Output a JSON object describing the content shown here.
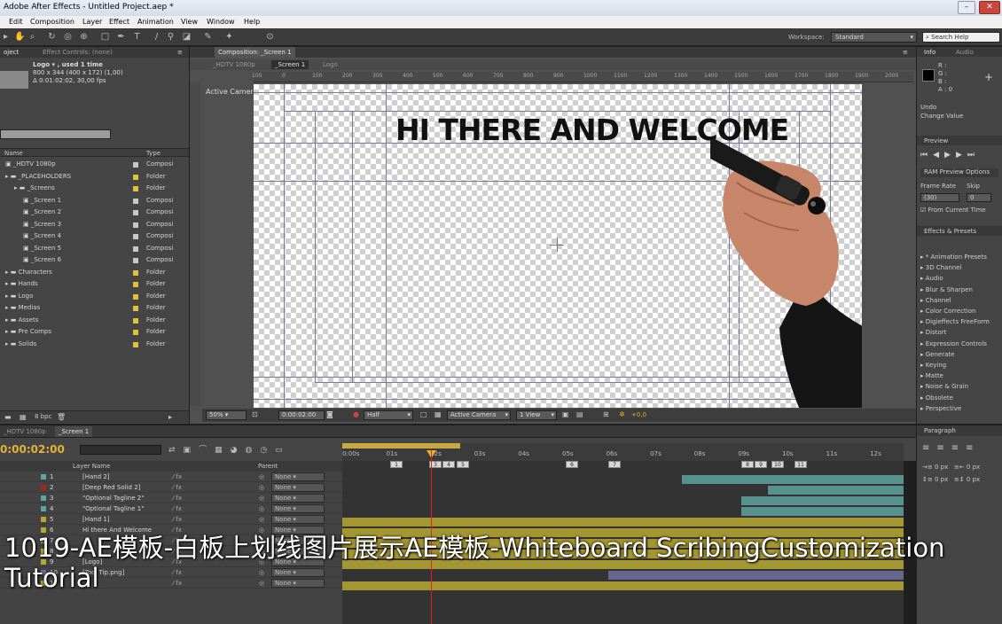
{
  "window": {
    "title": "Adobe After Effects - Untitled Project.aep *"
  },
  "menu": [
    "Edit",
    "Composition",
    "Layer",
    "Effect",
    "Animation",
    "View",
    "Window",
    "Help"
  ],
  "toolbar": {
    "workspace_label": "Workspace:",
    "workspace_value": "Standard",
    "search_help_placeholder": "Search Help"
  },
  "project": {
    "tab_project": "oject",
    "tab_effect_controls": "Effect Controls: (none)",
    "selected_name": "Logo ▾ , used 1 time",
    "selected_dims": "800 x 344  (400 x 172) (1,00)",
    "selected_duration": "Δ 0:01:02:02, 30,00 fps",
    "col_name": "Name",
    "col_type": "Type",
    "items": [
      {
        "name": "_HDTV 1080p",
        "type": "Composi",
        "color": "#c8c8c8"
      },
      {
        "name": "_PLACEHOLDERS",
        "type": "Folder",
        "color": "#e0c040"
      },
      {
        "name": "_Screens",
        "type": "Folder",
        "color": "#e0c040"
      },
      {
        "name": "_Screen 1",
        "type": "Composi",
        "color": "#c8c8c8"
      },
      {
        "name": "_Screen 2",
        "type": "Composi",
        "color": "#c8c8c8"
      },
      {
        "name": "_Screen 3",
        "type": "Composi",
        "color": "#c8c8c8"
      },
      {
        "name": "_Screen 4",
        "type": "Composi",
        "color": "#c8c8c8"
      },
      {
        "name": "_Screen 5",
        "type": "Composi",
        "color": "#c8c8c8"
      },
      {
        "name": "_Screen 6",
        "type": "Composi",
        "color": "#c8c8c8"
      },
      {
        "name": "Characters",
        "type": "Folder",
        "color": "#e0c040"
      },
      {
        "name": "Hands",
        "type": "Folder",
        "color": "#e0c040"
      },
      {
        "name": "Logo",
        "type": "Folder",
        "color": "#e0c040"
      },
      {
        "name": "Medias",
        "type": "Folder",
        "color": "#e0c040"
      },
      {
        "name": "Assets",
        "type": "Folder",
        "color": "#e0c040"
      },
      {
        "name": "Pre Comps",
        "type": "Folder",
        "color": "#e0c040"
      },
      {
        "name": "Solids",
        "type": "Folder",
        "color": "#e0c040"
      }
    ],
    "bpc": "8 bpc"
  },
  "composition": {
    "tab": "Composition: _Screen 1",
    "breadcrumb": [
      "_HDTV 1080p",
      "_Screen 1",
      "Logo"
    ],
    "camera_label": "Active Camera",
    "headline": "HI THERE AND WELCOME",
    "ruler_ticks": [
      "100",
      "0",
      "100",
      "200",
      "300",
      "400",
      "500",
      "600",
      "700",
      "800",
      "900",
      "1000",
      "1100",
      "1200",
      "1300",
      "1400",
      "1500",
      "1600",
      "1700",
      "1800",
      "1900",
      "2000"
    ],
    "footer": {
      "zoom": "50%",
      "timecode": "0:00:02:00",
      "resolution": "Half",
      "camera": "Active Camera",
      "view": "1 View",
      "exposure": "+0,0"
    }
  },
  "info_panel": {
    "tab_info": "Info",
    "tab_audio": "Audio",
    "r": "R :",
    "g": "G :",
    "b": "B :",
    "a": "A : 0",
    "undo": "Undo",
    "undo_action": "Change Value"
  },
  "preview_panel": {
    "tab": "Preview",
    "ram_options": "RAM Preview Options",
    "frame_rate": "Frame Rate",
    "skip": "Skip",
    "frame_rate_value": "(30)",
    "skip_value": "0",
    "from_current": "From Current Time"
  },
  "effects_panel": {
    "tab": "Effects & Presets",
    "items": [
      "* Animation Presets",
      "3D Channel",
      "Audio",
      "Blur & Sharpen",
      "Channel",
      "Color Correction",
      "Digieffects FreeForm",
      "Distort",
      "Expression Controls",
      "Generate",
      "Keying",
      "Matte",
      "Noise & Grain",
      "Obsolete",
      "Perspective"
    ]
  },
  "timeline": {
    "tabs": [
      "_HDTV 1080p",
      "_Screen 1"
    ],
    "current_time": "0:00:02:00",
    "col_layer_name": "Layer Name",
    "col_parent": "Parent",
    "time_ticks": [
      "0:00s",
      "01s",
      "02s",
      "03s",
      "04s",
      "05s",
      "06s",
      "07s",
      "08s",
      "09s",
      "10s",
      "11s",
      "12s"
    ],
    "markers": [
      "1",
      "3",
      "4",
      "5",
      "6",
      "7",
      "8",
      "9",
      "10",
      "11"
    ],
    "layers": [
      {
        "num": "1",
        "name": "[Hand 2]",
        "color": "#5ea3a0",
        "parent": "None"
      },
      {
        "num": "2",
        "name": "[Deep Red Solid 2]",
        "color": "#b02020",
        "parent": "None"
      },
      {
        "num": "3",
        "name": "\"Optional Tagline 2\"",
        "color": "#5ea3a0",
        "parent": "None"
      },
      {
        "num": "4",
        "name": "\"Optional Tagline 1\"",
        "color": "#5ea3a0",
        "parent": "None"
      },
      {
        "num": "5",
        "name": "[Hand 1]",
        "color": "#b8a830",
        "parent": "None"
      },
      {
        "num": "6",
        "name": "Hi there And Welcome",
        "color": "#b8a830",
        "parent": "None"
      },
      {
        "num": "7",
        "name": "",
        "color": "#b8a830",
        "parent": "None"
      },
      {
        "num": "8",
        "name": "",
        "color": "#b8a830",
        "parent": "None"
      },
      {
        "num": "9",
        "name": "[Logo]",
        "color": "#b8a830",
        "parent": "None"
      },
      {
        "num": "10",
        "name": "[Tool Tip.png]",
        "color": "#7070a0",
        "parent": "None"
      },
      {
        "num": "11",
        "name": "",
        "color": "#b8a830",
        "parent": "None"
      }
    ]
  },
  "paragraph_panel": {
    "tab": "Paragraph",
    "indent_value": "0 px"
  },
  "overlay_caption": "1019-AE模板-白板上划线图片展示AE模板-Whiteboard ScribingCustomization Tutorial"
}
